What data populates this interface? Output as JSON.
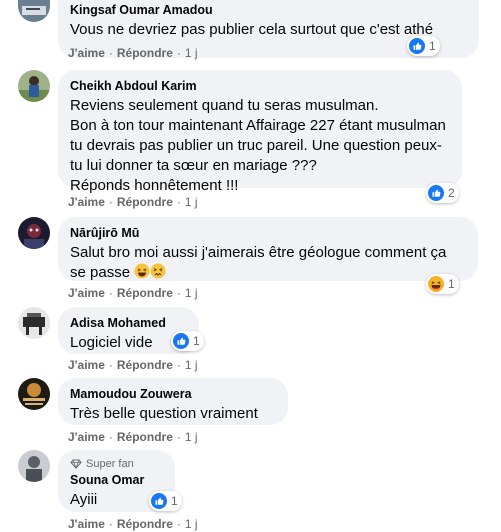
{
  "colors": {
    "like_blue": "#1877f2",
    "haha_yellow": "#f7b125",
    "bubble": "#f0f2f5",
    "meta_gray": "#65676b"
  },
  "comments": [
    {
      "author": "Kingsaf Oumar Amadou",
      "lines": [
        "Vous ne devriez pas publier cela surtout que c'est athé"
      ],
      "like": "J'aime",
      "reply": "Répondre",
      "time": "1 j",
      "reaction": "like-icon",
      "reaction_count": "1"
    },
    {
      "author": "Cheikh Abdoul Karim",
      "lines": [
        "Reviens seulement quand tu seras musulman.",
        "Bon à ton tour maintenant Affairage 227 étant musulman",
        "tu devrais pas publier un truc pareil. Une question peux-",
        "tu lui donner ta sœur en mariage ???",
        "Réponds honnêtement !!!"
      ],
      "like": "J'aime",
      "reply": "Répondre",
      "time": "1 j",
      "reaction": "like-icon",
      "reaction_count": "2"
    },
    {
      "author": "Nārûjirō Mū",
      "lines": [
        "Salut bro moi aussi j'aimerais être géologue comment ça",
        "se passe"
      ],
      "emojis": [
        "laughing-face-icon",
        "confounded-face-icon"
      ],
      "like": "J'aime",
      "reply": "Répondre",
      "time": "1 j",
      "reaction": "haha-icon",
      "reaction_count": "1"
    },
    {
      "author": "Adisa Mohamed",
      "lines": [
        "Logiciel vide"
      ],
      "like": "J'aime",
      "reply": "Répondre",
      "time": "1 j",
      "reaction": "like-icon",
      "reaction_count": "1"
    },
    {
      "author": "Mamoudou Zouwera",
      "lines": [
        "Très belle question vraiment"
      ],
      "like": "J'aime",
      "reply": "Répondre",
      "time": "1 j"
    },
    {
      "badge": "Super fan",
      "author": "Souna Omar",
      "lines": [
        "Ayiii"
      ],
      "like": "J'aime",
      "reply": "Répondre",
      "time": "1 j",
      "reaction": "like-icon",
      "reaction_count": "1"
    }
  ]
}
